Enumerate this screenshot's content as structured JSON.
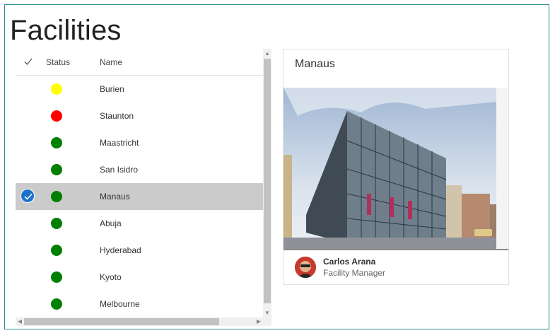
{
  "page": {
    "title": "Facilities"
  },
  "list": {
    "columns": {
      "check_icon": "checkmark-icon",
      "status": "Status",
      "name": "Name"
    },
    "rows": [
      {
        "name": "Burien",
        "status_color": "#ffff00",
        "selected": false
      },
      {
        "name": "Staunton",
        "status_color": "#ff0000",
        "selected": false
      },
      {
        "name": "Maastricht",
        "status_color": "#008000",
        "selected": false
      },
      {
        "name": "San Isidro",
        "status_color": "#008000",
        "selected": false
      },
      {
        "name": "Manaus",
        "status_color": "#008000",
        "selected": true
      },
      {
        "name": "Abuja",
        "status_color": "#008000",
        "selected": false
      },
      {
        "name": "Hyderabad",
        "status_color": "#008000",
        "selected": false
      },
      {
        "name": "Kyoto",
        "status_color": "#008000",
        "selected": false
      },
      {
        "name": "Melbourne",
        "status_color": "#008000",
        "selected": false
      }
    ]
  },
  "detail": {
    "title": "Manaus",
    "person": {
      "name": "Carlos Arana",
      "role": "Facility Manager"
    }
  },
  "colors": {
    "selection": "#cbcbcb",
    "check_accent": "#1a73c9",
    "frame": "#2b8b95"
  }
}
